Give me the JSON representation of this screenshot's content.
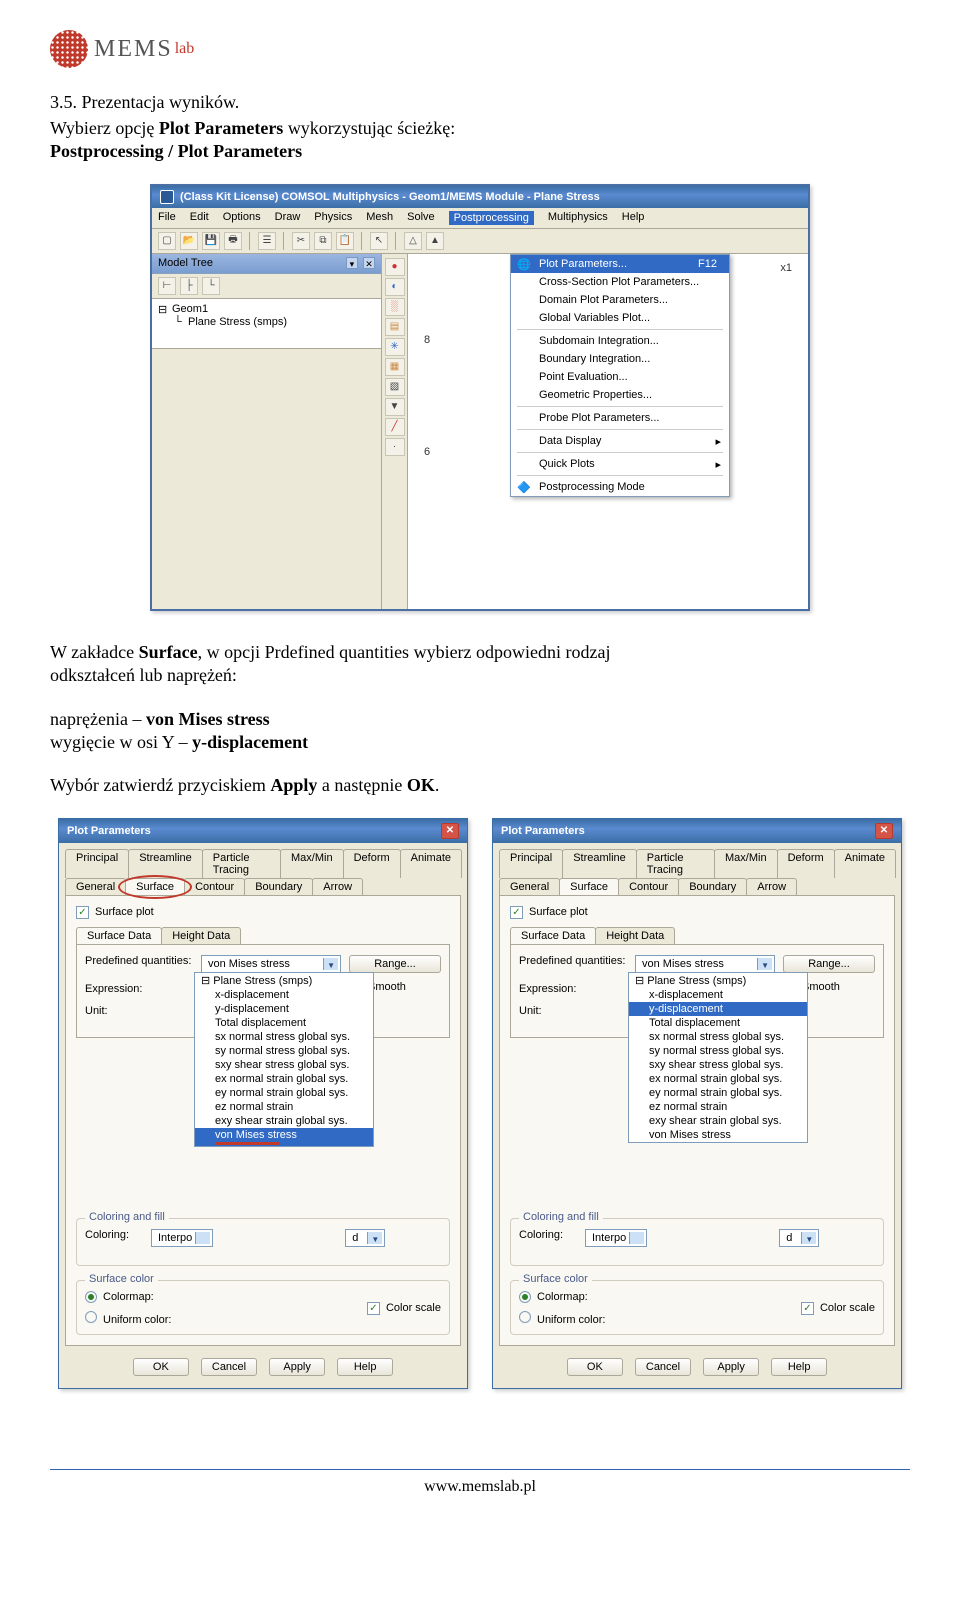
{
  "logo": {
    "text": "MEMS",
    "sub": "lab"
  },
  "section": {
    "title": "3.5. Prezentacja wyników.",
    "line1a": "Wybierz opcję ",
    "line1b": "Plot Parameters",
    "line1c": " wykorzystując ścieżkę:",
    "line2": "Postprocessing / Plot Parameters",
    "mid1a": "W zakładce ",
    "mid1b": "Surface",
    "mid1c": ",",
    "mid2a": " w opcji Prdefined quantities wybierz odpowiedni rodzaj",
    "mid3": "odkształceń lub naprężeń:",
    "stress_a": "naprężenia – ",
    "stress_b": "von Mises stress",
    "disp_a": "wygięcie w osi Y – ",
    "disp_b": "y-displacement",
    "confirm_a": "Wybór zatwierdź przyciskiem ",
    "confirm_b": "Apply",
    "confirm_c": " a następnie ",
    "confirm_d": "OK",
    "confirm_e": "."
  },
  "comsol": {
    "title": "(Class Kit License) COMSOL Multiphysics - Geom1/MEMS Module - Plane Stress",
    "menus": [
      "File",
      "Edit",
      "Options",
      "Draw",
      "Physics",
      "Mesh",
      "Solve",
      "Postprocessing",
      "Multiphysics",
      "Help"
    ],
    "active_menu_index": 7,
    "tree_panel_title": "Model Tree",
    "tree_root": "Geom1",
    "tree_child": "Plane Stress (smps)",
    "axis_x_label": "x1",
    "axis_ticks": [
      "8",
      "6"
    ],
    "menu_items": [
      {
        "label": "Plot Parameters...",
        "shortcut": "F12",
        "sel": true,
        "icon": "plot"
      },
      {
        "label": "Cross-Section Plot Parameters..."
      },
      {
        "label": "Domain Plot Parameters..."
      },
      {
        "label": "Global Variables Plot..."
      },
      {
        "sep": true
      },
      {
        "label": "Subdomain Integration..."
      },
      {
        "label": "Boundary Integration..."
      },
      {
        "label": "Point Evaluation..."
      },
      {
        "label": "Geometric Properties..."
      },
      {
        "sep": true
      },
      {
        "label": "Probe Plot Parameters..."
      },
      {
        "sep": true
      },
      {
        "label": "Data Display",
        "arrow": true
      },
      {
        "sep": true
      },
      {
        "label": "Quick Plots",
        "arrow": true
      },
      {
        "sep": true
      },
      {
        "label": "Postprocessing Mode",
        "icon": "mode"
      }
    ]
  },
  "dlg": {
    "title": "Plot Parameters",
    "tabs_row1": [
      "Principal",
      "Streamline",
      "Particle Tracing",
      "Max/Min",
      "Deform",
      "Animate"
    ],
    "tabs_row2": [
      "General",
      "Surface",
      "Contour",
      "Boundary",
      "Arrow"
    ],
    "active_tab": "Surface",
    "surface_plot": "Surface plot",
    "subtabs": [
      "Surface Data",
      "Height Data"
    ],
    "active_subtab": "Surface Data",
    "predef_label": "Predefined quantities:",
    "predef_value": "von Mises stress",
    "expr_label": "Expression:",
    "unit_label": "Unit:",
    "range_btn": "Range...",
    "smooth": "Smooth",
    "group_coloring": "Coloring and fill",
    "coloring_label": "Coloring:",
    "coloring_value": "Interpo",
    "coloring_suffix": "d",
    "group_surface": "Surface color",
    "colormap": "Colormap:",
    "uniform": "Uniform color:",
    "colorscale": "Color scale",
    "buttons": [
      "OK",
      "Cancel",
      "Apply",
      "Help"
    ],
    "dropdown_group": "Plane Stress (smps)",
    "dropdown_items": [
      "x-displacement",
      "y-displacement",
      "Total displacement",
      "sx normal stress global sys.",
      "sy normal stress global sys.",
      "sxy shear stress global sys.",
      "ex normal strain global sys.",
      "ey normal strain global sys.",
      "ez normal strain",
      "exy shear strain global sys.",
      "von Mises stress"
    ],
    "selected_left_index": 10,
    "selected_right_index": 1
  },
  "footer": {
    "url": "www.memslab.pl"
  }
}
